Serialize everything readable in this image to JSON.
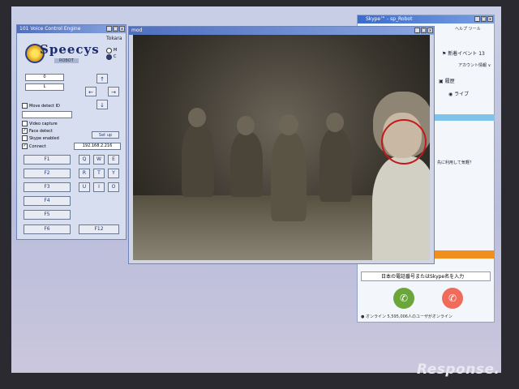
{
  "control_panel": {
    "title": "101 Voice Control Engine",
    "sign": "Tokara",
    "logo_text": "Speecys",
    "logo_sub": "ROBOT",
    "mode_options": [
      "M",
      "C"
    ],
    "field_top": "0",
    "field_bottom": "L",
    "move_detect": "Move detect ID",
    "video_capture": "Video capture",
    "face_detect": "Face detect",
    "skype_enabled": "Skype enabled",
    "connect": "Connect",
    "setup": "Set up",
    "ip_value": "192.168.2.216",
    "arrows": [
      "↑",
      "←",
      "→",
      "↓"
    ],
    "f_buttons": [
      "F1",
      "F2",
      "F3",
      "F4",
      "F5",
      "F6"
    ],
    "f12": "F12",
    "letter_keys": [
      "Q",
      "W",
      "E",
      "R",
      "T",
      "Y",
      "U",
      "I",
      "O"
    ]
  },
  "video_window": {
    "title": "mod"
  },
  "skype": {
    "title": "Skype™ - sp_Robot",
    "menu": "ヘルプ ツール",
    "event": "新着イベント 13",
    "account": "アカウント情報 ∨",
    "contacts": "履歴",
    "live": "ライブ",
    "message": "先に利用して気軽？",
    "phone_placeholder": "日本の電話番号またはSkype名を入力",
    "status": "オンライン  5,595,006人のユーザがオンライン"
  },
  "watermark": "Response."
}
